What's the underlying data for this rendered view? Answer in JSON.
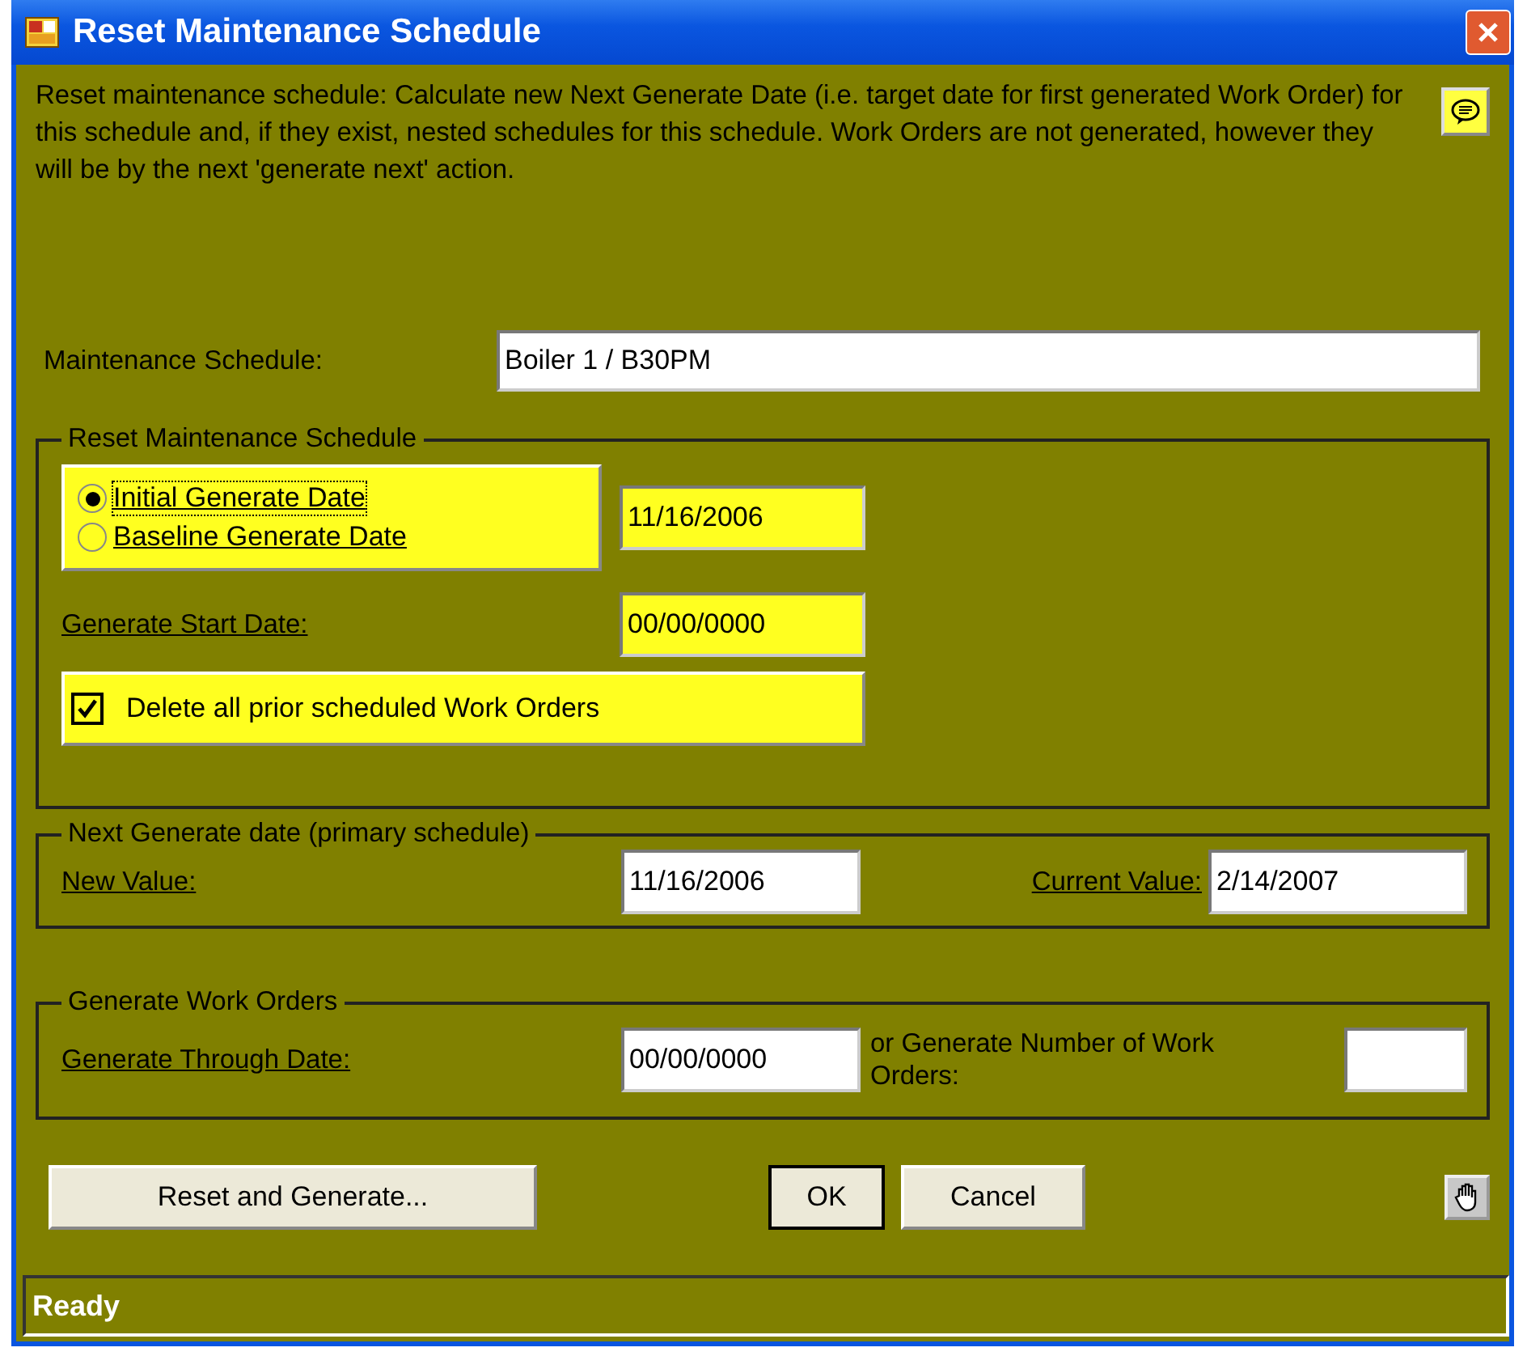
{
  "window": {
    "title": "Reset Maintenance Schedule"
  },
  "description": "Reset maintenance schedule: Calculate new Next Generate Date (i.e. target date for first generated Work Order) for this schedule and, if they exist, nested schedules for this schedule.  Work Orders are not generated, however they will be by the next 'generate next' action.",
  "schedule_field": {
    "label": "Maintenance Schedule:",
    "value": "Boiler 1 / B30PM"
  },
  "reset_group": {
    "title": "Reset Maintenance Schedule",
    "options": [
      {
        "label": "Initial Generate Date",
        "selected": true
      },
      {
        "label": "Baseline Generate Date",
        "selected": false
      }
    ],
    "date_value": "11/16/2006",
    "start_date": {
      "label": "Generate Start Date:",
      "value": "00/00/0000"
    },
    "delete_prior": {
      "label": "Delete all prior scheduled Work Orders",
      "checked": true
    }
  },
  "next_group": {
    "title": "Next Generate date (primary schedule)",
    "new_value": {
      "label": "New Value:",
      "value": "11/16/2006"
    },
    "current_value": {
      "label": "Current Value:",
      "value": "2/14/2007"
    }
  },
  "generate_group": {
    "title": "Generate Work Orders",
    "through_date": {
      "label": "Generate Through Date:",
      "value": "00/00/0000"
    },
    "number": {
      "label": "or Generate Number of Work Orders:"
    }
  },
  "buttons": [
    {
      "label": "Reset and Generate...",
      "kind": "wide"
    },
    {
      "label": "OK",
      "kind": "default"
    },
    {
      "label": "Cancel",
      "kind": "normal"
    }
  ],
  "status_bar": "Ready"
}
